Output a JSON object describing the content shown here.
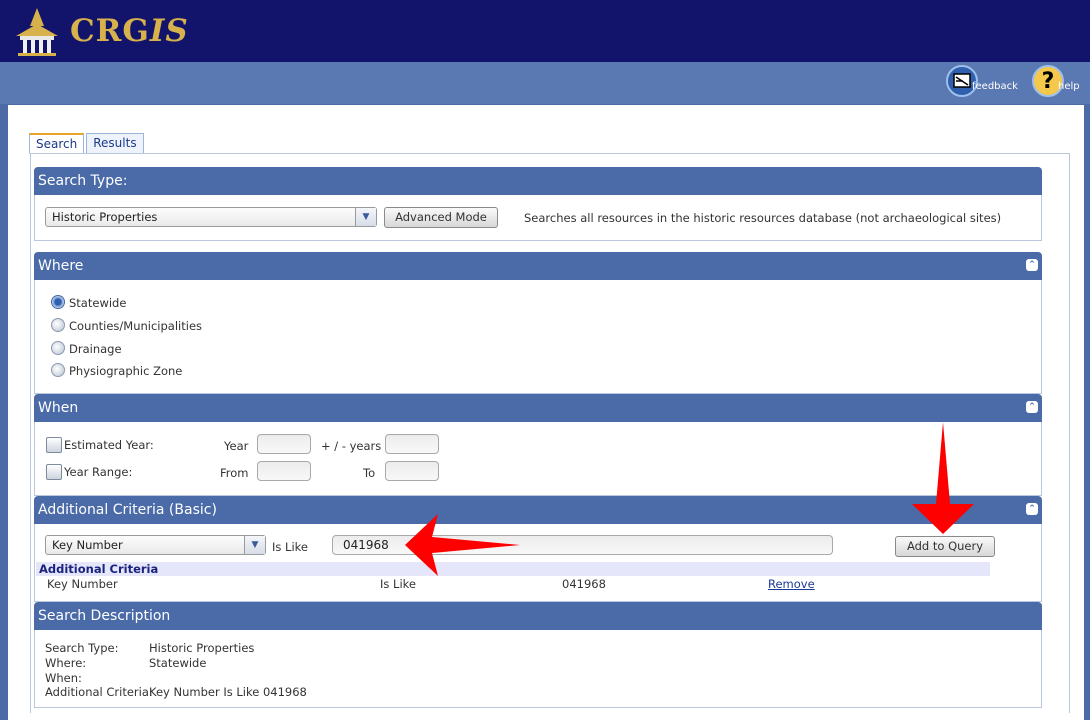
{
  "app": {
    "brand_prefix": "CRG",
    "brand_suffix": "IS"
  },
  "toolbar": {
    "feedback_label": "feedback",
    "help_label": "help"
  },
  "tabs": [
    {
      "label": "Search",
      "active": true
    },
    {
      "label": "Results",
      "active": false
    }
  ],
  "search_type": {
    "title": "Search Type:",
    "selected": "Historic Properties",
    "advanced_button": "Advanced Mode",
    "description": "Searches all resources in the historic resources database (not archaeological sites)"
  },
  "where": {
    "title": "Where",
    "options": [
      "Statewide",
      "Counties/Municipalities",
      "Drainage",
      "Physiographic Zone"
    ],
    "selected": "Statewide"
  },
  "when": {
    "title": "When",
    "estimated_year_label": "Estimated Year:",
    "year_label": "Year",
    "plus_minus_label": "+ / - years",
    "year_range_label": "Year Range:",
    "from_label": "From",
    "to_label": "To"
  },
  "additional": {
    "title": "Additional Criteria (Basic)",
    "field": "Key Number",
    "operator": "Is Like",
    "value": "041968",
    "add_button": "Add to Query",
    "table_header": "Additional Criteria",
    "row": {
      "field": "Key Number",
      "operator": "Is Like",
      "value": "041968",
      "action": "Remove"
    }
  },
  "description": {
    "title": "Search Description",
    "lines": [
      {
        "label": "Search Type:",
        "value": "Historic Properties"
      },
      {
        "label": "Where:",
        "value": "Statewide"
      },
      {
        "label": "When:",
        "value": ""
      },
      {
        "label": "Additional Criteria:",
        "value": "Key Number Is Like 041968"
      }
    ]
  },
  "colors": {
    "header_navy": "#12136a",
    "section_blue": "#4a6aa8",
    "brand_gold": "#d6b14c",
    "annotation_red": "#ff0000"
  }
}
